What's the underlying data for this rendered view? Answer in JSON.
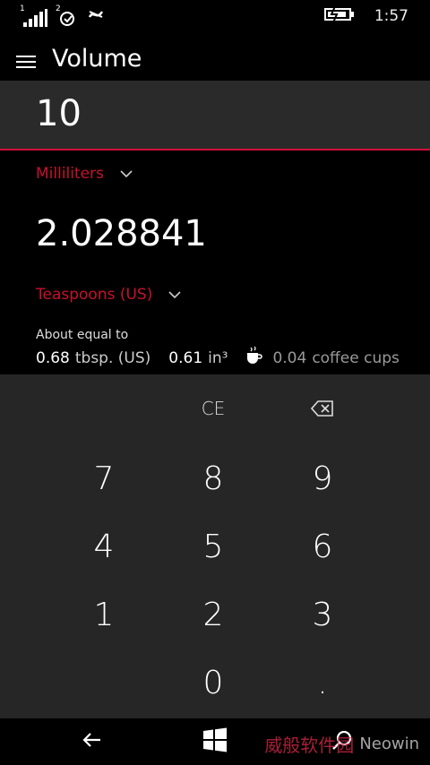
{
  "status_bar": {
    "signal_label": "1",
    "sync_label": "2",
    "time": "1:57",
    "icons": [
      "signal-icon",
      "sync-icon",
      "nfc-icon",
      "battery-charging-icon"
    ]
  },
  "header": {
    "title": "Volume"
  },
  "input": {
    "value": "10",
    "unit": "Milliliters"
  },
  "output": {
    "value": "2.028841",
    "unit": "Teaspoons (US)"
  },
  "about": {
    "label": "About equal to",
    "items": [
      {
        "value": "0.68",
        "unit": "tbsp. (US)"
      },
      {
        "value": "0.61",
        "unit": "in³"
      },
      {
        "value": "0.04",
        "unit": "coffee cups",
        "icon": "coffee-cup-icon"
      }
    ]
  },
  "keypad": {
    "ce": "CE",
    "k7": "7",
    "k8": "8",
    "k9": "9",
    "k4": "4",
    "k5": "5",
    "k6": "6",
    "k1": "1",
    "k2": "2",
    "k3": "3",
    "k0": "0",
    "dot": "."
  },
  "navbar": {
    "icons": [
      "back-icon",
      "windows-icon",
      "search-icon"
    ]
  },
  "watermark": {
    "text": "威般软件园",
    "brand": "Neowin"
  },
  "colors": {
    "accent": "#c8102e",
    "keypad_bg": "#262626",
    "input_bg": "#2a2a2a"
  }
}
